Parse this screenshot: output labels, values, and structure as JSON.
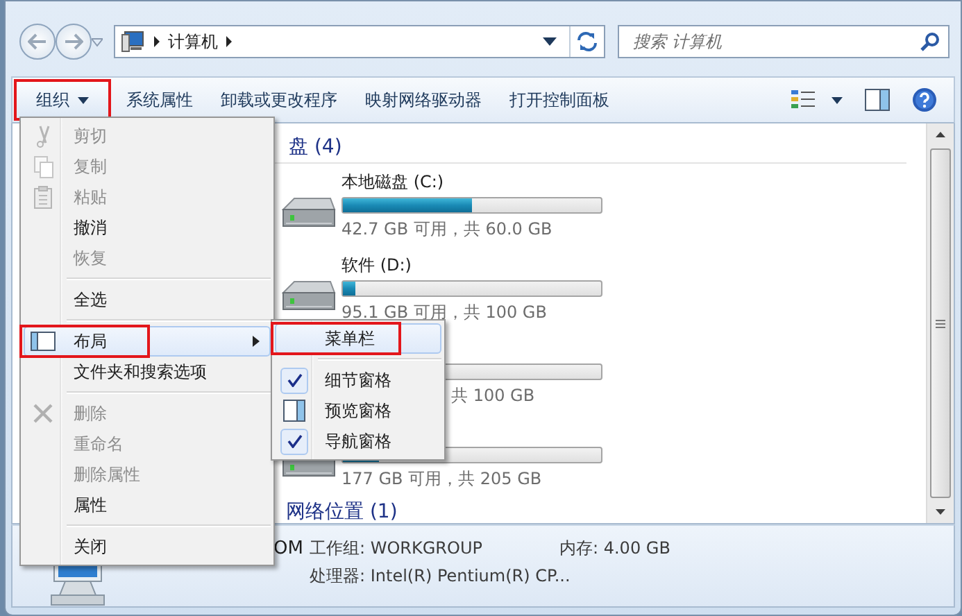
{
  "address": {
    "crumbs": [
      "计算机"
    ]
  },
  "search": {
    "placeholder": "搜索 计算机"
  },
  "toolbar": {
    "items": [
      {
        "label": "组织",
        "kind": "dropdown",
        "marked": true
      },
      {
        "label": "系统属性",
        "kind": "button",
        "marked": false
      },
      {
        "label": "卸载或更改程序",
        "kind": "button",
        "marked": false
      },
      {
        "label": "映射网络驱动器",
        "kind": "button",
        "marked": false
      },
      {
        "label": "打开控制面板",
        "kind": "button",
        "marked": false
      }
    ]
  },
  "groups": [
    {
      "heading": "盘 (4)",
      "drives": [
        {
          "name": "本地磁盘 (C:)",
          "level": 0.5,
          "info": "42.7 GB 可用，共 60.0 GB"
        },
        {
          "name": "软件 (D:)",
          "level": 0.05,
          "info": "95.1 GB 可用，共 100 GB"
        },
        {
          "info": "共 100 GB",
          "covered": true
        },
        {
          "level": 0.14,
          "info": "177 GB 可用，共 205 GB"
        }
      ]
    },
    {
      "heading": "网络位置 (1)"
    }
  ],
  "details": {
    "name": "OM",
    "workgroup": "工作组: WORKGROUP",
    "memory": "内存: 4.00 GB",
    "processor": "处理器: Intel(R) Pentium(R) CP..."
  },
  "menu": {
    "items": [
      {
        "kind": "item",
        "label": "剪切",
        "disabled": true,
        "selected": false,
        "marked": false,
        "submenu": false
      },
      {
        "kind": "item",
        "label": "复制",
        "disabled": true,
        "selected": false,
        "marked": false,
        "submenu": false
      },
      {
        "kind": "item",
        "label": "粘贴",
        "disabled": true,
        "selected": false,
        "marked": false,
        "submenu": false
      },
      {
        "kind": "item",
        "label": "撤消",
        "disabled": false,
        "selected": false,
        "marked": false,
        "submenu": false
      },
      {
        "kind": "item",
        "label": "恢复",
        "disabled": true,
        "selected": false,
        "marked": false,
        "submenu": false
      },
      {
        "kind": "separator"
      },
      {
        "kind": "item",
        "label": "全选",
        "disabled": false,
        "selected": false,
        "marked": false,
        "submenu": false
      },
      {
        "kind": "separator"
      },
      {
        "kind": "item",
        "label": "布局",
        "disabled": false,
        "selected": true,
        "marked": true,
        "submenu": true
      },
      {
        "kind": "item",
        "label": "文件夹和搜索选项",
        "disabled": false,
        "selected": false,
        "marked": false,
        "submenu": false
      },
      {
        "kind": "separator"
      },
      {
        "kind": "item",
        "label": "删除",
        "disabled": true,
        "selected": false,
        "marked": false,
        "submenu": false
      },
      {
        "kind": "item",
        "label": "重命名",
        "disabled": true,
        "selected": false,
        "marked": false,
        "submenu": false
      },
      {
        "kind": "item",
        "label": "删除属性",
        "disabled": true,
        "selected": false,
        "marked": false,
        "submenu": false
      },
      {
        "kind": "item",
        "label": "属性",
        "disabled": false,
        "selected": false,
        "marked": false,
        "submenu": false
      },
      {
        "kind": "separator"
      },
      {
        "kind": "item",
        "label": "关闭",
        "disabled": false,
        "selected": false,
        "marked": false,
        "submenu": false
      }
    ]
  },
  "submenu": {
    "items": [
      {
        "kind": "item",
        "label": "菜单栏",
        "checked": false,
        "selected": true,
        "marked": true
      },
      {
        "kind": "separator"
      },
      {
        "kind": "item",
        "label": "细节窗格",
        "checked": true,
        "selected": false,
        "marked": false
      },
      {
        "kind": "item",
        "label": "预览窗格",
        "checked": false,
        "selected": false,
        "marked": false
      },
      {
        "kind": "item",
        "label": "导航窗格",
        "checked": true,
        "selected": false,
        "marked": false
      }
    ]
  }
}
